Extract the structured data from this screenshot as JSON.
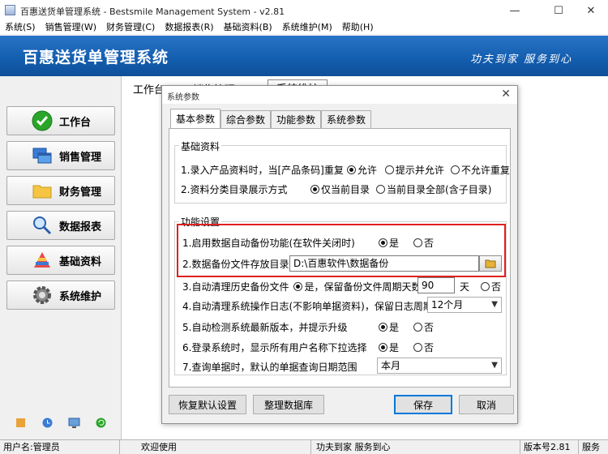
{
  "window": {
    "title": "百惠送货单管理系统 - Bestsmile Management System - v2.81",
    "min_symbol": "—",
    "max_symbol": "☐",
    "close_symbol": "✕"
  },
  "menu": [
    "系统(S)",
    "销售管理(W)",
    "财务管理(C)",
    "数据报表(R)",
    "基础资料(B)",
    "系统维护(M)",
    "帮助(H)"
  ],
  "banner": {
    "title": "百惠送货单管理系统",
    "slogan": "功夫到家 服务到心"
  },
  "nav": [
    {
      "label": "工作台",
      "icon": "check-circle-icon"
    },
    {
      "label": "销售管理",
      "icon": "windows-stack-icon"
    },
    {
      "label": "财务管理",
      "icon": "folder-icon"
    },
    {
      "label": "数据报表",
      "icon": "magnifier-icon"
    },
    {
      "label": "基础资料",
      "icon": "color-palette-icon"
    },
    {
      "label": "系统维护",
      "icon": "gear-icon"
    }
  ],
  "main_tabs": [
    "工作台",
    "销售管理",
    "系统维护"
  ],
  "status": {
    "user": "用户名:管理员",
    "welcome": "欢迎使用",
    "slogan": "功夫到家 服务到心",
    "version": "版本号2.81",
    "extra": "服务"
  },
  "dialog": {
    "title": "系统参数",
    "close": "✕",
    "tabs": [
      "基本参数",
      "综合参数",
      "功能参数",
      "系统参数"
    ],
    "active_tab": "基本参数",
    "group_basic": {
      "label": "基础资料",
      "row1": {
        "text": "1.录入产品资料时，当[产品条码]重复",
        "opts": [
          "允许",
          "提示并允许",
          "不允许重复"
        ],
        "selected": "允许"
      },
      "row2": {
        "text": "2.资料分类目录展示方式",
        "opts": [
          "仅当前目录",
          "当前目录全部(含子目录)"
        ],
        "selected": "仅当前目录"
      }
    },
    "group_func": {
      "label": "功能设置",
      "row1": {
        "text": "1.启用数据自动备份功能(在软件关闭时)",
        "opts": [
          "是",
          "否"
        ],
        "selected": "是"
      },
      "row2": {
        "text": "2.数据备份文件存放目录",
        "value": "D:\\百惠软件\\数据备份"
      },
      "row3": {
        "text": "3.自动清理历史备份文件",
        "opt_yes": "是，保留备份文件周期天数",
        "days": "90",
        "unit": "天",
        "opt_no": "否",
        "selected": "yes"
      },
      "row4": {
        "text": "4.自动清理系统操作日志(不影响单据资料)，保留日志周期",
        "value": "12个月"
      },
      "row5": {
        "text": "5.自动检测系统最新版本，并提示升级",
        "opts": [
          "是",
          "否"
        ],
        "selected": "是"
      },
      "row6": {
        "text": "6.登录系统时，显示所有用户名称下拉选择",
        "opts": [
          "是",
          "否"
        ],
        "selected": "是"
      },
      "row7": {
        "text": "7.查询单据时，默认的单据查询日期范围",
        "value": "本月"
      }
    },
    "buttons": {
      "restore": "恢复默认设置",
      "tidy": "整理数据库",
      "save": "保存",
      "cancel": "取消"
    }
  },
  "colors": {
    "banner": "#135dae",
    "highlight": "#e02020",
    "primary_border": "#0078d7"
  }
}
